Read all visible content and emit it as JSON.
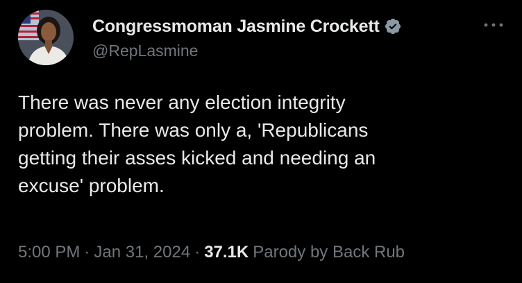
{
  "author": {
    "display_name": "Congressmoman Jasmine Crockett",
    "handle": "@RepLasmine",
    "verified_color": "#8b98a5"
  },
  "tweet": {
    "lines": [
      "There was never any election integrity",
      "problem. There was only a, 'Republicans",
      "getting their asses kicked and needing an",
      "excuse' problem."
    ]
  },
  "meta": {
    "time": "5:00 PM",
    "separator": "·",
    "date": "Jan 31, 2024",
    "views": "37.1K",
    "label": "Parody by Back Rub"
  },
  "colors": {
    "background": "#000000",
    "primary_text": "#e7e9ea",
    "secondary_text": "#71767b"
  },
  "icons": {
    "verified": "verified-badge-icon",
    "more": "more-options-icon"
  }
}
